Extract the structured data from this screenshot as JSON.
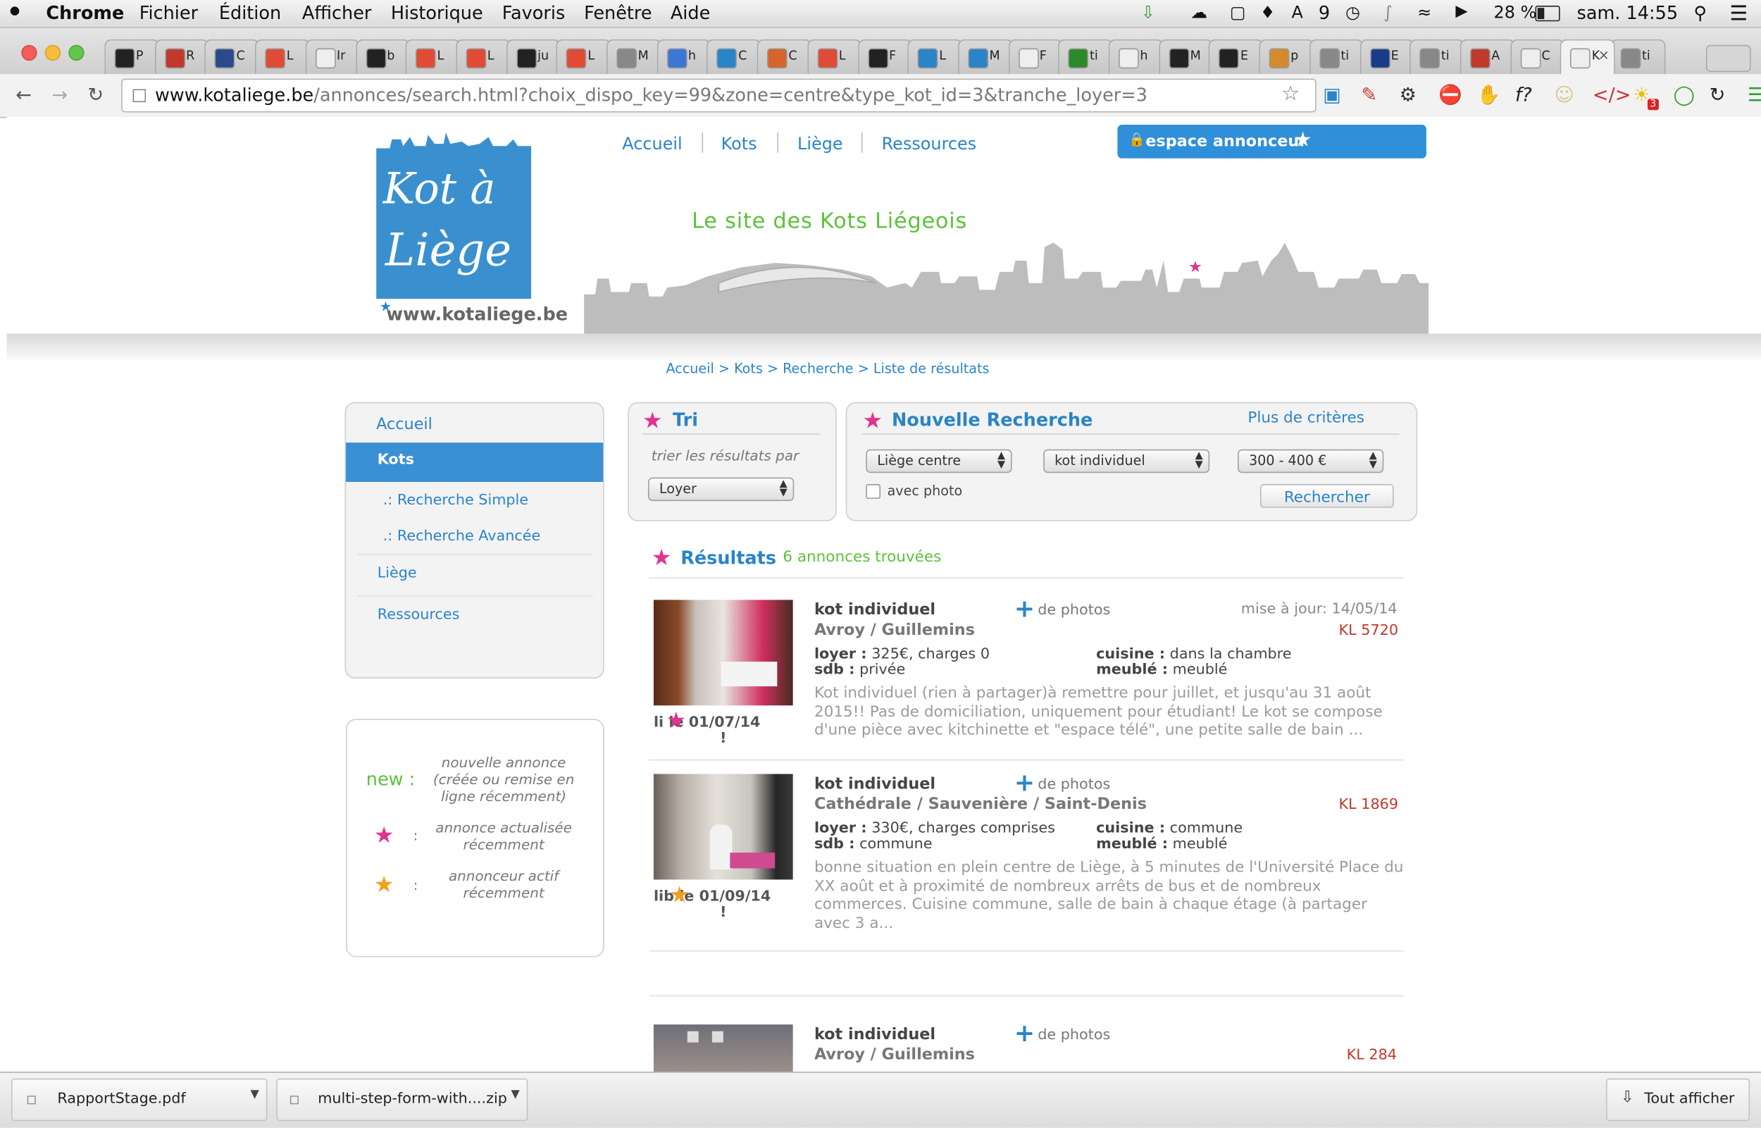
{
  "menubar": {
    "apple": "",
    "items": [
      "Chrome",
      "Fichier",
      "Édition",
      "Afficher",
      "Historique",
      "Favoris",
      "Fenêtre",
      "Aide"
    ],
    "status": {
      "notif_count": "9",
      "battery": "28 %",
      "datetime": "sam. 14:55"
    }
  },
  "browser": {
    "tabs": [
      "P",
      "R",
      "C",
      "L",
      "Ir",
      "b",
      "L",
      "L",
      "ju",
      "L",
      "M",
      "h",
      "C",
      "C",
      "L",
      "F",
      "L",
      "M",
      "F",
      "ti",
      "h",
      "M",
      "E",
      "p",
      "ti",
      "E",
      "ti",
      "A",
      "C",
      "K",
      "ti"
    ],
    "url_domain": "www.kotaliege.be",
    "url_path": "/annonces/search.html?choix_dispo_key=99&zone=centre&type_kot_id=3&tranche_loyer=3",
    "ext_badge": "3"
  },
  "site": {
    "logo_line1": "Kot à",
    "logo_line2": "Liège",
    "logo_url": "www.kotaliege.be",
    "tagline": "Le site des Kots Liégeois",
    "nav": [
      "Accueil",
      "Kots",
      "Liège",
      "Ressources"
    ],
    "espace": "espace annonceur"
  },
  "breadcrumb": [
    "Accueil",
    ">",
    "Kots",
    ">",
    "Recherche",
    ">",
    "Liste de résultats"
  ],
  "sidebar": {
    "items": [
      "Accueil",
      "Kots",
      ".: Recherche Simple",
      ".: Recherche Avancée",
      "Liège",
      "Ressources"
    ],
    "legend": {
      "new_label": "new :",
      "new_text": "nouvelle annonce (créée ou remise en ligne récemment)",
      "sep": ":",
      "pink_text": "annonce actualisée récemment",
      "orange_text": "annonceur actif récemment"
    }
  },
  "tri": {
    "title": "Tri",
    "subtitle": "trier les résultats par",
    "select": "Loyer"
  },
  "search": {
    "title": "Nouvelle Recherche",
    "more": "Plus de critères",
    "zone": "Liège centre",
    "type": "kot individuel",
    "price": "300 - 400 €",
    "photo_label": "avec photo",
    "button": "Rechercher"
  },
  "results": {
    "title": "Résultats",
    "count": "6 annonces trouvées",
    "items": [
      {
        "type": "kot individuel",
        "more_photos": "de photos",
        "updated": "mise à jour: 14/05/14",
        "location": "Avroy / Guillemins",
        "ref": "KL 5720",
        "loyer_label": "loyer :",
        "loyer": "325€, charges 0",
        "cuisine_label": "cuisine :",
        "cuisine": "dans la chambre",
        "sdb_label": "sdb :",
        "sdb": "privée",
        "meuble_label": "meublé :",
        "meuble": "meublé",
        "dispo": "li  le 01/07/14",
        "dispo2": "!",
        "desc": "Kot individuel (rien à partager)à remettre pour juillet, et jusqu'au 31 août 2015!! Pas de domiciliation, uniquement pour étudiant! Le kot se compose d'une pièce avec kitchinette et \"espace télé\", une petite salle de bain ..."
      },
      {
        "type": "kot individuel",
        "more_photos": "de photos",
        "updated": "",
        "location": "Cathédrale / Sauvenière / Saint-Denis",
        "ref": "KL 1869",
        "loyer_label": "loyer :",
        "loyer": "330€, charges comprises",
        "cuisine_label": "cuisine :",
        "cuisine": "commune",
        "sdb_label": "sdb :",
        "sdb": "commune",
        "meuble_label": "meublé :",
        "meuble": "meublé",
        "dispo": "lib  le 01/09/14",
        "dispo2": "!",
        "desc": "bonne situation en plein centre de Liège, à 5 minutes de l'Université Place du XX août et à proximité de nombreux arrêts de bus et de nombreux commerces. Cuisine commune, salle de bain à chaque étage (à partager avec 3 a..."
      },
      {
        "type": "kot individuel",
        "more_photos": "de photos",
        "location": "Avroy / Guillemins",
        "ref": "KL 284"
      }
    ]
  },
  "downloads": {
    "files": [
      "RapportStage.pdf",
      "multi-step-form-with....zip"
    ],
    "show_all": "Tout afficher"
  },
  "colors": {
    "accent_blue": "#2a84c8",
    "pink_star": "#e0338f",
    "orange_star": "#f2a020",
    "green": "#5cc23a",
    "ref_red": "#c0392b"
  }
}
